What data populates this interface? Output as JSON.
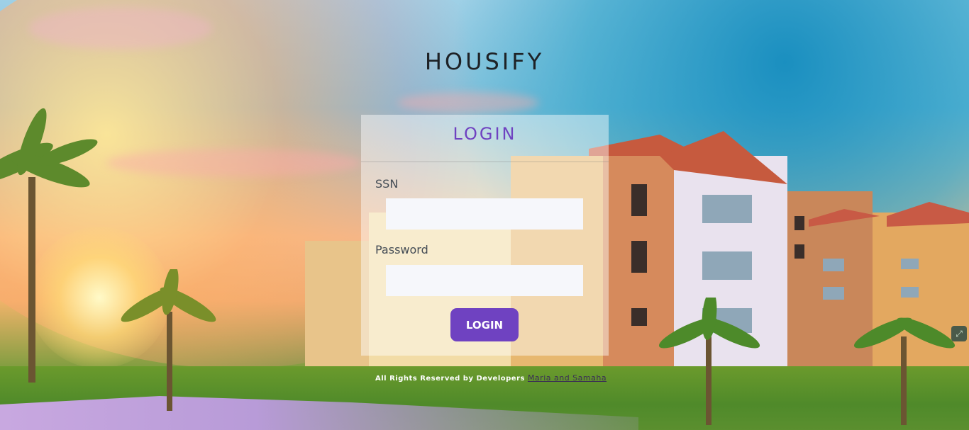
{
  "brand": {
    "title": "HOUSIFY"
  },
  "login": {
    "heading": "LOGIN",
    "ssn_label": "SSN",
    "ssn_value": "",
    "password_label": "Password",
    "password_value": "",
    "submit_label": "LOGIN"
  },
  "footer": {
    "text": "All Rights Reserved by Developers",
    "link_text": "Maria and Samaha"
  },
  "corner_widget": {
    "icon": "expand-icon"
  },
  "colors": {
    "accent": "#6f42c1",
    "title_text": "#1e2226",
    "input_bg": "#f6f7fb"
  }
}
